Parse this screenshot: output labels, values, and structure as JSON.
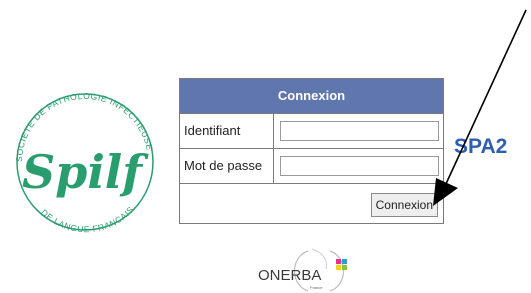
{
  "logo_spilf": {
    "arc_top": "SOCIETE DE PATHOLOGIE INFECTIEUSE",
    "arc_bottom": "DE LANGUE FRANCAISE",
    "name": "Spilf"
  },
  "login": {
    "header": "Connexion",
    "username_label": "Identifiant",
    "username_value": "",
    "password_label": "Mot de passe",
    "password_value": "",
    "submit_label": "Connexion"
  },
  "annotation_label": "SPA2",
  "logo_onerba": {
    "name": "ONERBA",
    "subtitle": "France"
  },
  "colors": {
    "header_bg": "#5f77ad",
    "spa2_text": "#2f5fae",
    "spilf_green": "#2a9d6e"
  }
}
